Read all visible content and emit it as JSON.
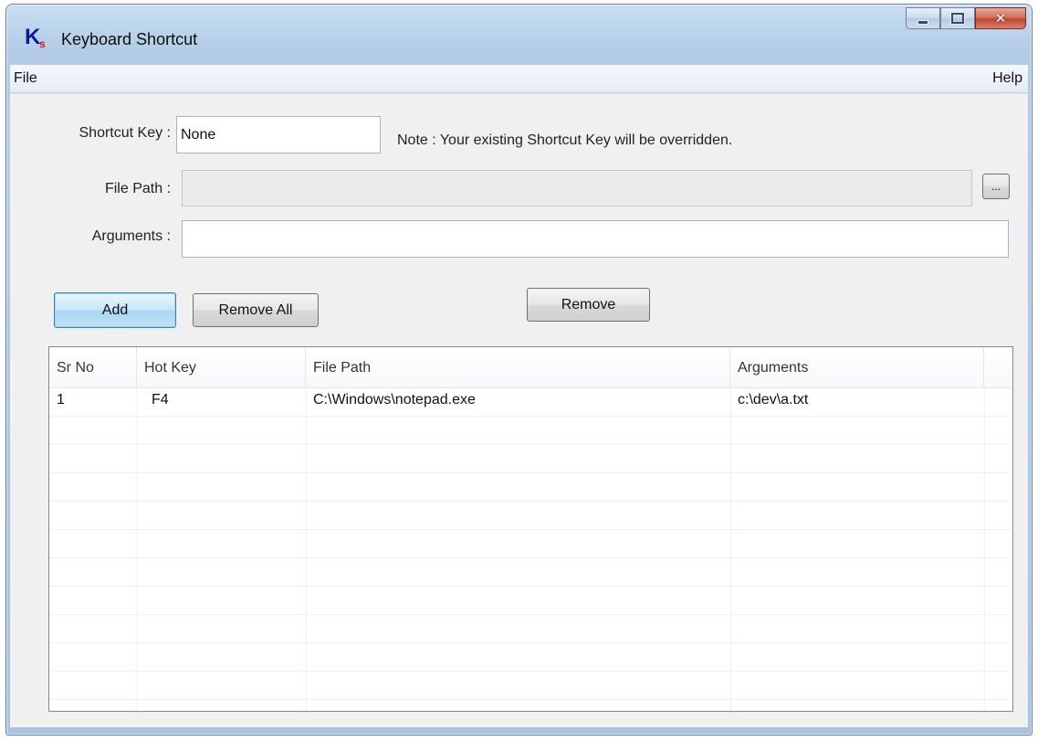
{
  "window": {
    "title": "Keyboard Shortcut",
    "logo_main": "K",
    "logo_sub": "s"
  },
  "icons": {
    "minimize": "minimize-icon",
    "maximize": "maximize-icon",
    "close": "close-icon"
  },
  "menu": {
    "file": "File",
    "help": "Help"
  },
  "form": {
    "shortcut_label": "Shortcut Key :",
    "shortcut_value": "None",
    "note": "Note :  Your existing Shortcut Key will be overridden.",
    "filepath_label": "File Path :",
    "filepath_value": "",
    "browse_label": "...",
    "arguments_label": "Arguments :",
    "arguments_value": ""
  },
  "buttons": {
    "add": "Add",
    "remove_all": "Remove All",
    "remove": "Remove"
  },
  "table": {
    "columns": [
      "Sr No",
      "Hot Key",
      "File Path",
      "Arguments"
    ],
    "rows": [
      [
        "1",
        "F4",
        "C:\\Windows\\notepad.exe",
        "c:\\dev\\a.txt"
      ]
    ]
  },
  "colors": {
    "window_frame": "#a8c3df",
    "client_bg": "#f0f0f0",
    "close_button": "#c24531",
    "default_button": "#a9d8f4"
  }
}
